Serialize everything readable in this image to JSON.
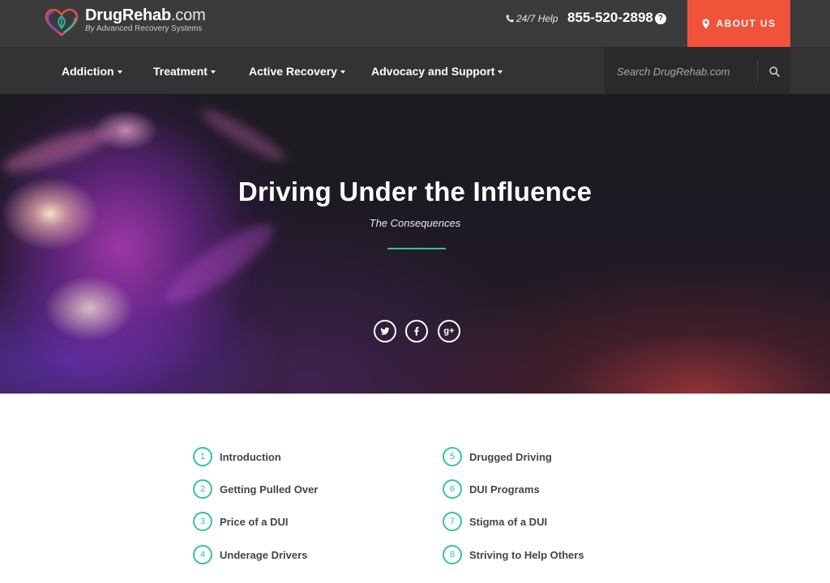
{
  "header": {
    "logo": {
      "brand": "DrugRehab",
      "tld": ".com",
      "sub_by": "By",
      "sub_company": "Advanced Recovery Systems"
    },
    "help_label": "24/7 Help",
    "phone": "855-520-2898",
    "help_badge": "?",
    "about_label": "ABOUT US",
    "colors": {
      "topbar": "#3b3b3e",
      "about_button": "#f0533a",
      "accent": "#35c2a3"
    }
  },
  "nav": {
    "items": [
      {
        "label": "Addiction"
      },
      {
        "label": "Treatment"
      },
      {
        "label": "Active Recovery"
      },
      {
        "label": "Advocacy and Support"
      }
    ],
    "search": {
      "placeholder": "Search DrugRehab.com",
      "icon": "search-icon"
    }
  },
  "hero": {
    "title": "Driving Under the Influence",
    "subtitle": "The Consequences",
    "social": [
      {
        "icon": "twitter-icon"
      },
      {
        "icon": "facebook-icon"
      },
      {
        "icon": "google-plus-icon",
        "text": "g+"
      }
    ]
  },
  "toc": {
    "left": [
      {
        "num": "1",
        "label": "Introduction"
      },
      {
        "num": "2",
        "label": "Getting Pulled Over"
      },
      {
        "num": "3",
        "label": "Price of a DUI"
      },
      {
        "num": "4",
        "label": "Underage Drivers"
      }
    ],
    "right": [
      {
        "num": "5",
        "label": "Drugged Driving"
      },
      {
        "num": "6",
        "label": "DUI Programs"
      },
      {
        "num": "7",
        "label": "Stigma of a DUI"
      },
      {
        "num": "8",
        "label": "Striving to Help Others"
      }
    ]
  }
}
